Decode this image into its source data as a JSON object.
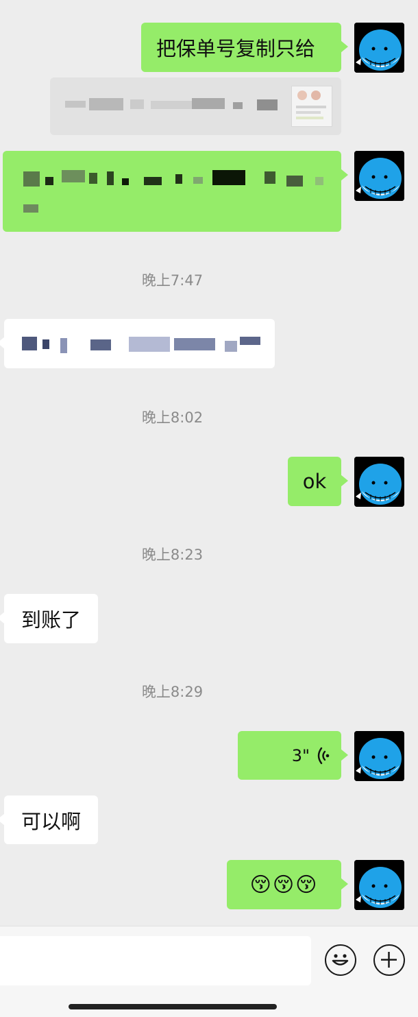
{
  "messages": {
    "m1_text": "把保单号复制只给",
    "ts1": "晚上7:47",
    "ts2": "晚上8:02",
    "m_ok": "ok",
    "ts3": "晚上8:23",
    "m_recv1": "到账了",
    "ts4": "晚上8:29",
    "voice_duration": "3\"",
    "m_recv2": "可以啊",
    "emoji_msg": "😚😚😚"
  },
  "colors": {
    "sent_bubble": "#95ec69",
    "received_bubble": "#ffffff",
    "background": "#ededed",
    "avatar_whale": "#1fa2e8"
  },
  "icons": {
    "avatar": "whale-avatar-icon",
    "voice": "voice-wave-icon",
    "emoji": "emoji-smile-icon",
    "plus": "plus-circle-icon"
  }
}
